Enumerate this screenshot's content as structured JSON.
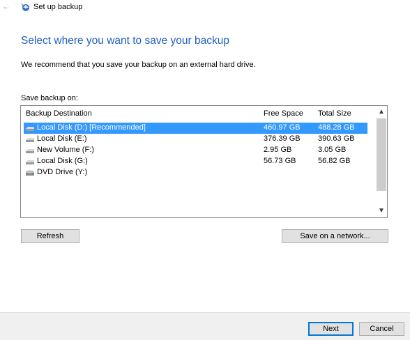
{
  "window": {
    "title": "Set up backup",
    "back_icon": "←"
  },
  "main": {
    "heading": "Select where you want to save your backup",
    "recommendation": "We recommend that you save your backup on an external hard drive.",
    "save_on_label": "Save backup on:"
  },
  "table": {
    "columns": {
      "destination": "Backup Destination",
      "free": "Free Space",
      "total": "Total Size"
    },
    "rows": [
      {
        "name": "Local Disk (D:) [Recommended]",
        "free": "460.97 GB",
        "total": "488.28 GB",
        "icon": "hard-drive-icon",
        "selected": true
      },
      {
        "name": "Local Disk (E:)",
        "free": "376.39 GB",
        "total": "390.63 GB",
        "icon": "hard-drive-icon"
      },
      {
        "name": "New Volume (F:)",
        "free": "2.95 GB",
        "total": "3.05 GB",
        "icon": "hard-drive-icon"
      },
      {
        "name": "Local Disk (G:)",
        "free": "56.73 GB",
        "total": "56.82 GB",
        "icon": "hard-drive-icon"
      },
      {
        "name": "DVD Drive (Y:)",
        "free": "",
        "total": "",
        "icon": "dvd-drive-icon"
      }
    ]
  },
  "buttons": {
    "refresh": "Refresh",
    "save_network": "Save on a network...",
    "next": "Next",
    "cancel": "Cancel"
  },
  "colors": {
    "accent": "#1f5fbf",
    "selection": "#3399ff",
    "footer_bg": "#f0f0f0"
  }
}
